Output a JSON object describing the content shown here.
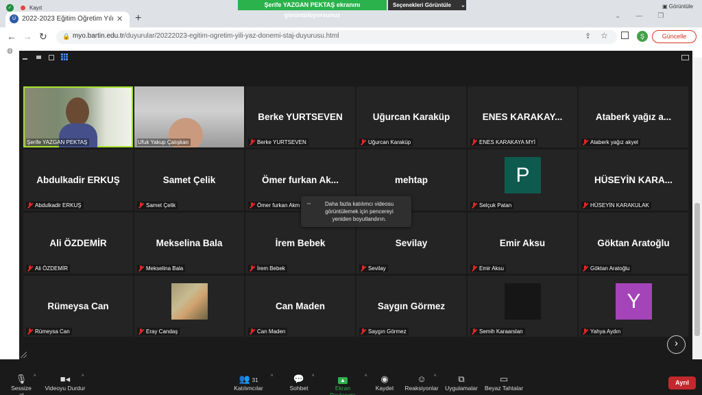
{
  "browser": {
    "recording_label": "Kayıt",
    "tab_title": "2022-2023 Eğitim Öğretim Yılı Yaz",
    "url_domain": "myo.bartin.edu.tr",
    "url_path": "/duyurular/20222023-egitim-ogretim-yili-yaz-donemi-staj-duyurusu.html",
    "update_button": "Güncelle",
    "profile_initial": "Ş",
    "view_button": "Görüntüle"
  },
  "share": {
    "banner": "Şerife YAZGAN PEKTAŞ ekranını görüntülüyorsunuz",
    "options": "Seçenekleri Görüntüle"
  },
  "participants": [
    {
      "tile": "",
      "label": "Şerife YAZGAN PEKTAŞ",
      "video": "woman"
    },
    {
      "tile": "",
      "label": "Ufuk Yakup Çalışkan",
      "video": "man"
    },
    {
      "tile": "Berke YURTSEVEN",
      "label": "Berke YURTSEVEN"
    },
    {
      "tile": "Uğurcan Karaküp",
      "label": "Uğurcan Karaküp"
    },
    {
      "tile": "ENES KARAKAY...",
      "label": "ENES KARAKAYA MYİ"
    },
    {
      "tile": "Ataberk yağız a...",
      "label": "Ataberk yağız akyel"
    },
    {
      "tile": "Abdulkadir ERKUŞ",
      "label": "Abdulkadir ERKUŞ"
    },
    {
      "tile": "Samet Çelik",
      "label": "Samet Çelik"
    },
    {
      "tile": "Ömer furkan Ak...",
      "label": "Ömer furkan Akm"
    },
    {
      "tile": "mehtap",
      "label": ""
    },
    {
      "tile": "",
      "label": "Selçuk Patan",
      "avatar": "P",
      "avatar_color": "#0e5a4f"
    },
    {
      "tile": "HÜSEYİN KARA...",
      "label": "HÜSEYİN KARAKULAK"
    },
    {
      "tile": "Ali ÖZDEMİR",
      "label": "Ali ÖZDEMİR"
    },
    {
      "tile": "Mekselina Bala",
      "label": "Mekselina Bala"
    },
    {
      "tile": "İrem Bebek",
      "label": "İrem Bebek"
    },
    {
      "tile": "Sevilay",
      "label": "Sevilay"
    },
    {
      "tile": "Emir Aksu",
      "label": "Emir Aksu"
    },
    {
      "tile": "Göktan Aratoğlu",
      "label": "Göktan Aratoğlu"
    },
    {
      "tile": "Rümeysa Can",
      "label": "Rümeysa Can"
    },
    {
      "tile": "",
      "label": "Eray Candaş",
      "photo": true
    },
    {
      "tile": "Can Maden",
      "label": "Can Maden"
    },
    {
      "tile": "Saygın Görmez",
      "label": "Saygın Görmez"
    },
    {
      "tile": "",
      "label": "Semih Karaarslan",
      "avatar": "",
      "avatar_color": "#161616"
    },
    {
      "tile": "",
      "label": "Yahya Aydın",
      "avatar": "Y",
      "avatar_color": "#a544b8"
    }
  ],
  "tooltip": "Daha fazla katılımcı videosu görüntülemek için pencereyi yeniden boyutlandırın.",
  "toolbar": {
    "mute": "Sessize al",
    "video": "Videoyu Durdur",
    "participants": "Katılımcılar",
    "participants_count": "31",
    "chat": "Sohbet",
    "share": "Ekran Paylaşımı",
    "record": "Kaydet",
    "reactions": "Reaksiyonlar",
    "apps": "Uygulamalar",
    "whiteboard": "Beyaz Tahtalar",
    "leave": "Ayrıl"
  },
  "colors": {
    "active_speaker": "#a6e22e",
    "share_green": "#2bb24c",
    "leave_red": "#c2282c"
  }
}
